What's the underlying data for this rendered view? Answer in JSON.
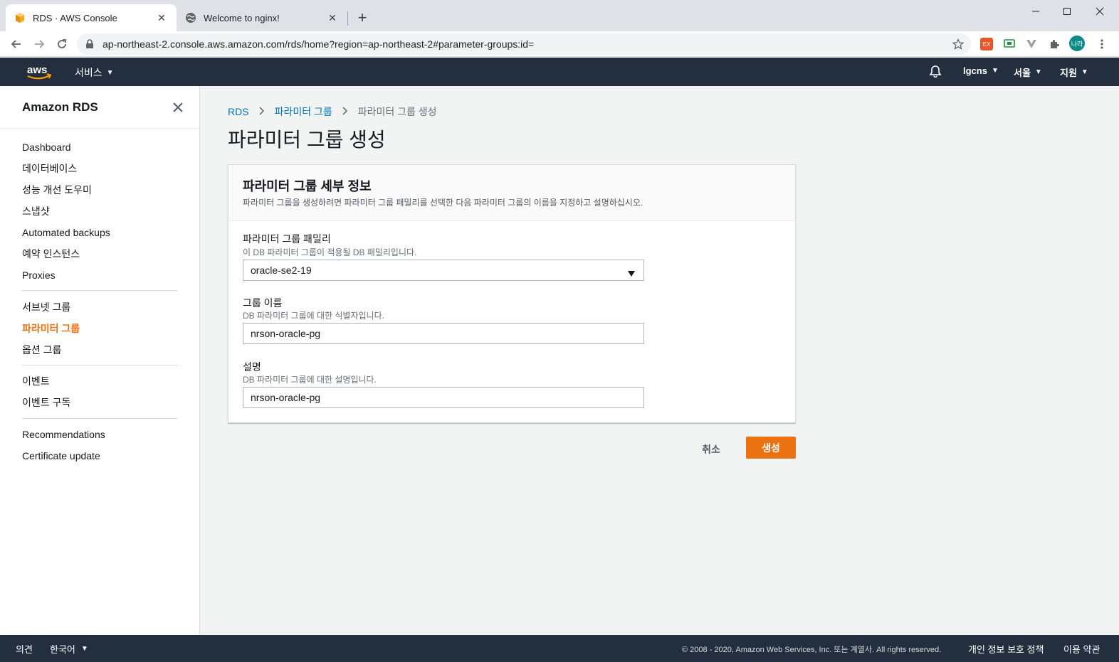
{
  "browser": {
    "tabs": [
      {
        "title": "RDS · AWS Console",
        "favicon": "aws-cube-icon",
        "active": true
      },
      {
        "title": "Welcome to nginx!",
        "favicon": "globe-icon",
        "active": false
      }
    ],
    "url": "ap-northeast-2.console.aws.amazon.com/rds/home?region=ap-northeast-2#parameter-groups:id=",
    "profile_label": "나라"
  },
  "aws_header": {
    "services_label": "서비스",
    "account_label": "lgcns",
    "region_label": "서울",
    "support_label": "지원"
  },
  "sidebar": {
    "title": "Amazon RDS",
    "groups": [
      [
        "Dashboard",
        "데이터베이스",
        "성능 개선 도우미",
        "스냅샷",
        "Automated backups",
        "예약 인스턴스",
        "Proxies"
      ],
      [
        "서브넷 그룹",
        "파라미터 그룹",
        "옵션 그룹"
      ],
      [
        "이벤트",
        "이벤트 구독"
      ],
      [
        "Recommendations",
        "Certificate update"
      ]
    ],
    "active_item": "파라미터 그룹"
  },
  "breadcrumb": {
    "root": "RDS",
    "parent": "파라미터 그룹",
    "current": "파라미터 그룹 생성"
  },
  "page_title": "파라미터 그룹 생성",
  "panel": {
    "title": "파라미터 그룹 세부 정보",
    "description": "파라미터 그룹을 생성하려면 파라미터 그룹 패밀리를 선택한 다음 파라미터 그룹의 이름을 지정하고 설명하십시오.",
    "family": {
      "label": "파라미터 그룹 패밀리",
      "hint": "이 DB 파라미터 그룹이 적용될 DB 패밀리입니다.",
      "value": "oracle-se2-19"
    },
    "group_name": {
      "label": "그룹 이름",
      "hint": "DB 파라미터 그룹에 대한 식별자입니다.",
      "value": "nrson-oracle-pg"
    },
    "description_field": {
      "label": "설명",
      "hint": "DB 파라미터 그룹에 대한 설명입니다.",
      "value": "nrson-oracle-pg"
    }
  },
  "actions": {
    "cancel_label": "취소",
    "create_label": "생성"
  },
  "footer": {
    "feedback_label": "의견",
    "language_label": "한국어",
    "copyright": "© 2008 - 2020, Amazon Web Services, Inc. 또는 계열사. All rights reserved.",
    "privacy_label": "개인 정보 보호 정책",
    "terms_label": "이용 약관"
  },
  "colors": {
    "aws_navy": "#232f3e",
    "accent_orange": "#ec7211",
    "link_blue": "#0073bb"
  }
}
